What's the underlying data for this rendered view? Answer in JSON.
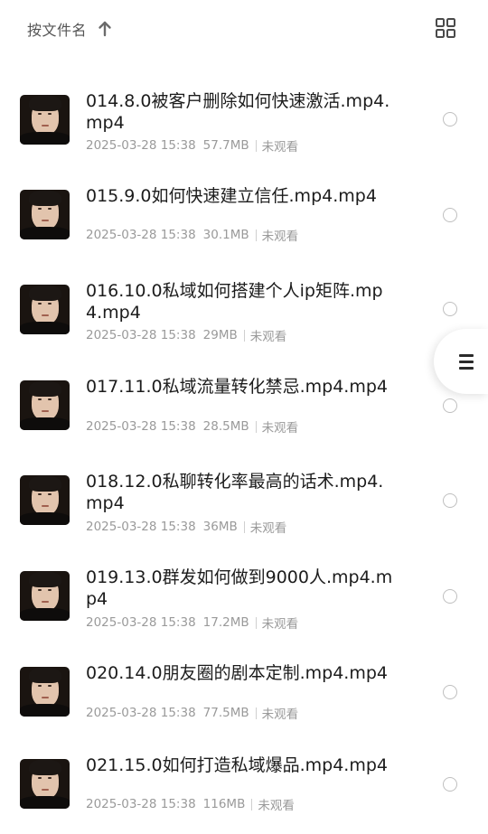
{
  "header": {
    "sort_label": "按文件名",
    "sort_direction_icon": "arrow-up-icon",
    "view_toggle_icon": "grid-view-icon"
  },
  "colors": {
    "title_text": "#1c1c1c",
    "meta_text": "#9a9a9a",
    "radio_border": "#bfbfbf"
  },
  "files": [
    {
      "title": "014.8.0被客户删除如何快速激活.mp4.mp4",
      "date": "2025-03-28 15:38",
      "size": "57.7MB",
      "status": "未观看"
    },
    {
      "title": "015.9.0如何快速建立信任.mp4.mp4",
      "date": "2025-03-28 15:38",
      "size": "30.1MB",
      "status": "未观看"
    },
    {
      "title": "016.10.0私域如何搭建个人ip矩阵.mp4.mp4",
      "date": "2025-03-28 15:38",
      "size": "29MB",
      "status": "未观看"
    },
    {
      "title": "017.11.0私域流量转化禁忌.mp4.mp4",
      "date": "2025-03-28 15:38",
      "size": "28.5MB",
      "status": "未观看"
    },
    {
      "title": "018.12.0私聊转化率最高的话术.mp4.mp4",
      "date": "2025-03-28 15:38",
      "size": "36MB",
      "status": "未观看"
    },
    {
      "title": "019.13.0群发如何做到9000人.mp4.mp4",
      "date": "2025-03-28 15:38",
      "size": "17.2MB",
      "status": "未观看"
    },
    {
      "title": "020.14.0朋友圈的剧本定制.mp4.mp4",
      "date": "2025-03-28 15:38",
      "size": "77.5MB",
      "status": "未观看"
    },
    {
      "title": "021.15.0如何打造私域爆品.mp4.mp4",
      "date": "2025-03-28 15:38",
      "size": "116MB",
      "status": "未观看"
    }
  ],
  "side_handle": {
    "icon": "menu-icon"
  }
}
